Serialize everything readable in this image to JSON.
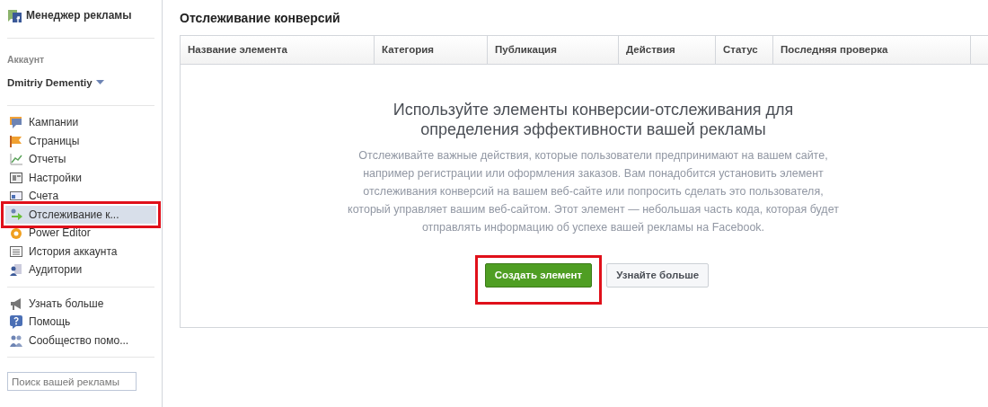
{
  "sidebar": {
    "app_title": "Менеджер рекламы",
    "account_label": "Аккаунт",
    "account_name": "Dmitriy Dementiy",
    "nav_groups": [
      [
        {
          "label": "Кампании",
          "selected": false,
          "highlighted": false
        },
        {
          "label": "Страницы",
          "selected": false,
          "highlighted": false
        },
        {
          "label": "Отчеты",
          "selected": false,
          "highlighted": false
        },
        {
          "label": "Настройки",
          "selected": false,
          "highlighted": false
        },
        {
          "label": "Счета",
          "selected": false,
          "highlighted": false
        },
        {
          "label": "Отслеживание к...",
          "selected": true,
          "highlighted": true
        },
        {
          "label": "Power Editor",
          "selected": false,
          "highlighted": false
        },
        {
          "label": "История аккаунта",
          "selected": false,
          "highlighted": false
        },
        {
          "label": "Аудитории",
          "selected": false,
          "highlighted": false
        }
      ],
      [
        {
          "label": "Узнать больше",
          "selected": false,
          "highlighted": false
        },
        {
          "label": "Помощь",
          "selected": false,
          "highlighted": false
        },
        {
          "label": "Сообщество помо...",
          "selected": false,
          "highlighted": false
        }
      ]
    ],
    "search": {
      "placeholder": "Поиск вашей рекламы"
    }
  },
  "main": {
    "title": "Отслеживание конверсий",
    "table": {
      "columns": [
        "Название элемента",
        "Категория",
        "Публикация",
        "Действия",
        "Статус",
        "Последняя проверка"
      ]
    },
    "empty_state": {
      "heading": "Используйте элементы конверсии-отслеживания для определения эффективности вашей рекламы",
      "text": "Отслеживайте важные действия, которые пользователи предпринимают на вашем сайте, например регистрации или оформления заказов. Вам понадобится установить элемент отслеживания конверсий на вашем веб-сайте или попросить сделать это пользователя, который управляет вашим веб-сайтом. Этот элемент — небольшая часть кода, которая будет отправлять информацию об успехе вашей рекламы на Facebook.",
      "buttons": [
        {
          "label": "Создать элемент",
          "kind": "primary",
          "highlighted": true
        },
        {
          "label": "Узнайте больше",
          "kind": "secondary",
          "highlighted": false
        }
      ]
    }
  }
}
